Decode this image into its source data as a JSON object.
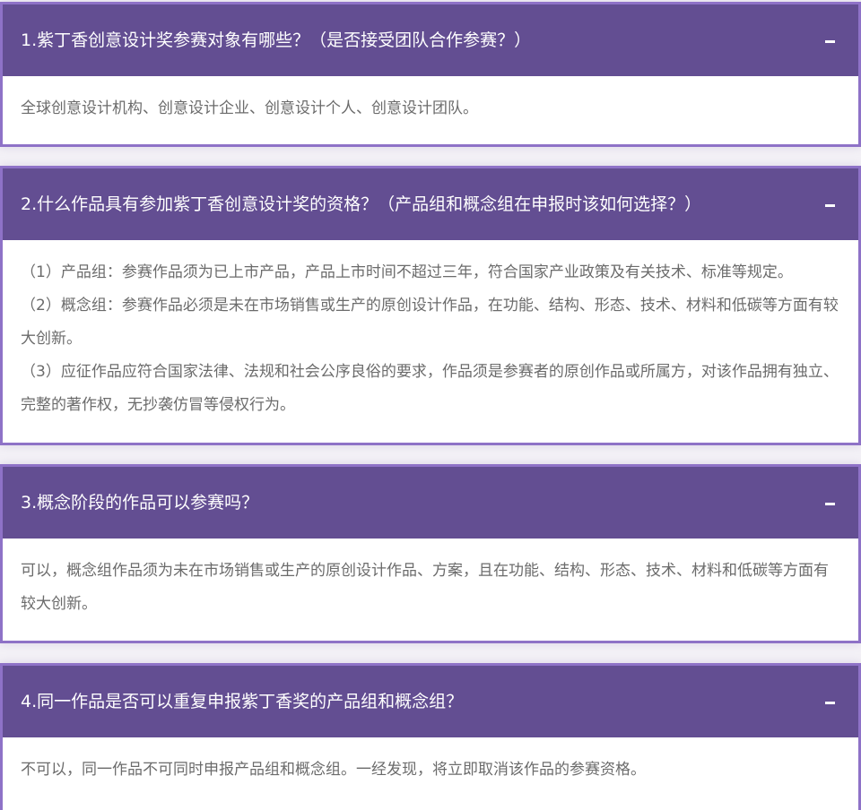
{
  "faq": [
    {
      "question": "1.紫丁香创意设计奖参赛对象有哪些？（是否接受团队合作参赛？）",
      "answer": [
        "全球创意设计机构、创意设计企业、创意设计个人、创意设计团队。"
      ]
    },
    {
      "question": "2.什么作品具有参加紫丁香创意设计奖的资格？（产品组和概念组在申报时该如何选择？）",
      "answer": [
        "（1）产品组：参赛作品须为已上市产品，产品上市时间不超过三年，符合国家产业政策及有关技术、标准等规定。",
        "（2）概念组：参赛作品必须是未在市场销售或生产的原创设计作品，在功能、结构、形态、技术、材料和低碳等方面有较大创新。",
        "（3）应征作品应符合国家法律、法规和社会公序良俗的要求，作品须是参赛者的原创作品或所属方，对该作品拥有独立、完整的著作权，无抄袭仿冒等侵权行为。"
      ]
    },
    {
      "question": "3.概念阶段的作品可以参赛吗？",
      "answer": [
        "可以，概念组作品须为未在市场销售或生产的原创设计作品、方案，且在功能、结构、形态、技术、材料和低碳等方面有较大创新。"
      ]
    },
    {
      "question": "4.同一作品是否可以重复申报紫丁香奖的产品组和概念组？",
      "answer": [
        "不可以，同一作品不可同时申报产品组和概念组。一经发现，将立即取消该作品的参赛资格。"
      ]
    }
  ],
  "icons": {
    "toggle": "minus-icon"
  },
  "colors": {
    "header_bg": "#634e92",
    "border": "#8e72c7",
    "answer_text": "#6b6b6b",
    "question_text": "#ffffff"
  }
}
